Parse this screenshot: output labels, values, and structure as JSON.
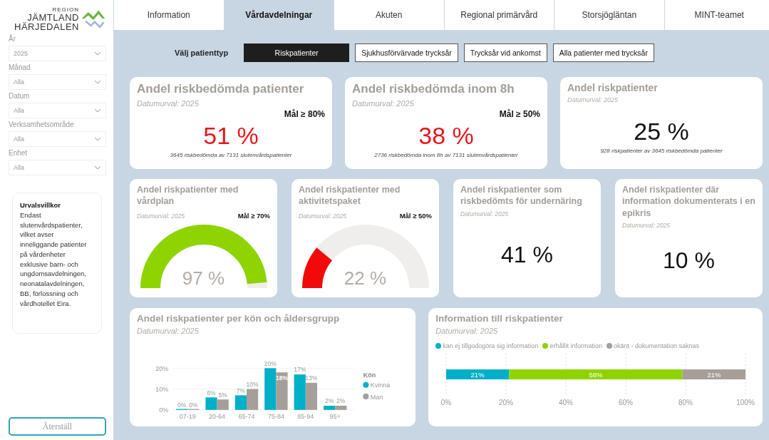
{
  "logo": {
    "region": "REGION",
    "line1": "JÄMTLAND",
    "line2": "HÄRJEDALEN"
  },
  "filters": [
    {
      "label": "År",
      "value": "2025"
    },
    {
      "label": "Månad",
      "value": "Alla"
    },
    {
      "label": "Datum",
      "value": "Alla"
    },
    {
      "label": "Verksamhetsområde",
      "value": "Alla"
    },
    {
      "label": "Enhet",
      "value": "Alla"
    }
  ],
  "criteria": {
    "title": "Urvalsvillkor",
    "text": "Endast slutenvårdspatienter, vilket avser inneliggande patienter på vårdenheter exklusive barn- och ungdomsavdelningen, neonatalavdelningen, BB,  förlossning och vårdhotellet Eira."
  },
  "reset_button": "Återställ",
  "tabs": [
    {
      "label": "Information",
      "selected": false
    },
    {
      "label": "Vårdavdelningar",
      "selected": true
    },
    {
      "label": "Akuten",
      "selected": false
    },
    {
      "label": "Regional primärvård",
      "selected": false
    },
    {
      "label": "Storsjögläntan",
      "selected": false
    },
    {
      "label": "MINT-teamet",
      "selected": false
    }
  ],
  "patient_type": {
    "label": "Välj patienttyp",
    "options": [
      {
        "label": "Riskpatienter",
        "selected": true
      },
      {
        "label": "Sjukhusförvärvade trycksår",
        "selected": false
      },
      {
        "label": "Trycksår vid ankomst",
        "selected": false
      },
      {
        "label": "Alla patienter med trycksår",
        "selected": false
      }
    ]
  },
  "kpi_row": [
    {
      "kind": "number",
      "title": "Andel riskbedömda patienter",
      "subtitle": "Datumurval: 2025",
      "goal": "Mål ≥ 80%",
      "goal_met": false,
      "value": "51 %",
      "footnote": "3645 riskbedömda av 7131 slutenvårdspatienter"
    },
    {
      "kind": "number",
      "title": "Andel riskbedömda inom 8h",
      "subtitle": "Datumurval: 2025",
      "goal": "Mål ≥ 50%",
      "goal_met": false,
      "value": "38 %",
      "footnote": "2736 riskbedömda inom 8h av 7131 slutenvårdspatienter"
    },
    {
      "kind": "plain",
      "title": "Andel riskpatienter",
      "subtitle": "Datumurval: 2025",
      "value": "25 %",
      "footnote": "928 riskpatienter av 3645 riskbedömda patienter"
    }
  ],
  "gauge_row": [
    {
      "kind": "gauge",
      "title": "Andel riskpatienter med vårdplan",
      "subtitle": "Datumurval: 2025",
      "goal": "Mål ≥ 70%",
      "goal_met": true,
      "value": "97 %"
    },
    {
      "kind": "gauge",
      "title": "Andel riskpatienter med aktivitetspaket",
      "subtitle": "Datumurval: 2025",
      "goal": "Mål ≥ 50%",
      "goal_met": false,
      "value": "22 %"
    },
    {
      "kind": "plain",
      "title": "Andel riskpatienter som riskbedömts för undernäring",
      "subtitle": "Datumurval: 2025",
      "value": "41 %"
    },
    {
      "kind": "plain",
      "title": "Andel riskpatienter där information dokumenterats i en epikris",
      "subtitle": "Datumurval: 2025",
      "value": "10 %"
    }
  ],
  "gender_chart": {
    "title": "Andel riskpatienter per kön och åldersgrupp",
    "subtitle": "Datumurval: 2025",
    "chart_data": {
      "type": "bar",
      "categories": [
        "07-19",
        "20-64",
        "65-74",
        "75-84",
        "85-94",
        "95+"
      ],
      "series": [
        {
          "name": "Kvinna",
          "color": "#00b0c8",
          "values": [
            0,
            6,
            7,
            20,
            17,
            2
          ],
          "value_labels": [
            "0%",
            "6%",
            "7%",
            "20%",
            "17%",
            "2%"
          ]
        },
        {
          "name": "Man",
          "color": "#a59e99",
          "values": [
            0,
            5,
            10,
            18,
            13,
            2
          ],
          "value_labels": [
            "0%",
            "5%",
            "10%",
            "18%",
            "13%",
            "2%"
          ]
        }
      ],
      "ylim": [
        0,
        20
      ],
      "yticks": [
        {
          "value": 0,
          "label": "0%"
        },
        {
          "value": 10,
          "label": "10%"
        },
        {
          "value": 20,
          "label": "20%"
        }
      ],
      "legend": {
        "title": "Kön"
      },
      "grid": true,
      "data_labels": true
    }
  },
  "info_chart": {
    "title": "Information till riskpatienter",
    "subtitle": "Datumurval: 2025",
    "chart_data": {
      "type": "bar",
      "orientation": "horizontal",
      "stacked": true,
      "series": [
        {
          "name": "kan ej tillgodogöra sig information",
          "color": "#00b0c8",
          "values": [
            21
          ],
          "value_labels": [
            "21%"
          ]
        },
        {
          "name": "erhållit information",
          "color": "#8fd400",
          "values": [
            58
          ],
          "value_labels": [
            "58%"
          ]
        },
        {
          "name": "okänt - dokumentation saknas",
          "color": "#a59e99",
          "values": [
            21
          ],
          "value_labels": [
            "21%"
          ]
        }
      ],
      "xlim": [
        0,
        100
      ],
      "xticks": [
        {
          "value": 0,
          "label": "0%"
        },
        {
          "value": 20,
          "label": "20%"
        },
        {
          "value": 40,
          "label": "40%"
        },
        {
          "value": 60,
          "label": "60%"
        },
        {
          "value": 80,
          "label": "80%"
        },
        {
          "value": 100,
          "label": "100%"
        }
      ],
      "legend": true,
      "grid": true,
      "data_labels": true
    }
  }
}
